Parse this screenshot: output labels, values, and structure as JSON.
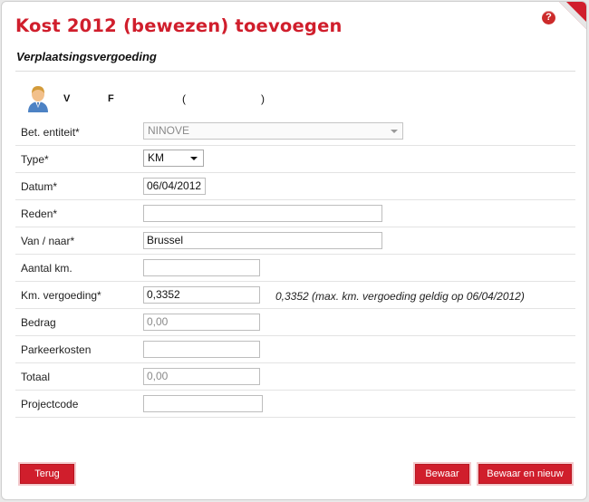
{
  "header": {
    "title": "Kost 2012 (bewezen) toevoegen",
    "subtitle": "Verplaatsingsvergoeding",
    "help_symbol": "?"
  },
  "user": {
    "icon": "person-icon",
    "first": "V",
    "second": "F",
    "paren_open": "(",
    "paren_close": ")"
  },
  "form": {
    "entity": {
      "label": "Bet. entiteit*",
      "value": "NINOVE"
    },
    "type": {
      "label": "Type*",
      "value": "KM"
    },
    "datum": {
      "label": "Datum*",
      "value": "06/04/2012"
    },
    "reden": {
      "label": "Reden*",
      "value": ""
    },
    "van_naar": {
      "label": "Van / naar*",
      "value": "Brussel"
    },
    "aantal_km": {
      "label": "Aantal km.",
      "value": ""
    },
    "km_vergoeding": {
      "label": "Km. vergoeding*",
      "value": "0,3352",
      "note": "0,3352 (max. km. vergoeding geldig op 06/04/2012)"
    },
    "bedrag": {
      "label": "Bedrag",
      "value": "0,00"
    },
    "parkeerkosten": {
      "label": "Parkeerkosten",
      "value": ""
    },
    "totaal": {
      "label": "Totaal",
      "value": "0,00"
    },
    "projectcode": {
      "label": "Projectcode",
      "value": ""
    }
  },
  "buttons": {
    "back": "Terug",
    "save": "Bewaar",
    "save_new": "Bewaar en nieuw"
  },
  "colors": {
    "accent": "#d01e2c",
    "background": "#ffffff"
  }
}
